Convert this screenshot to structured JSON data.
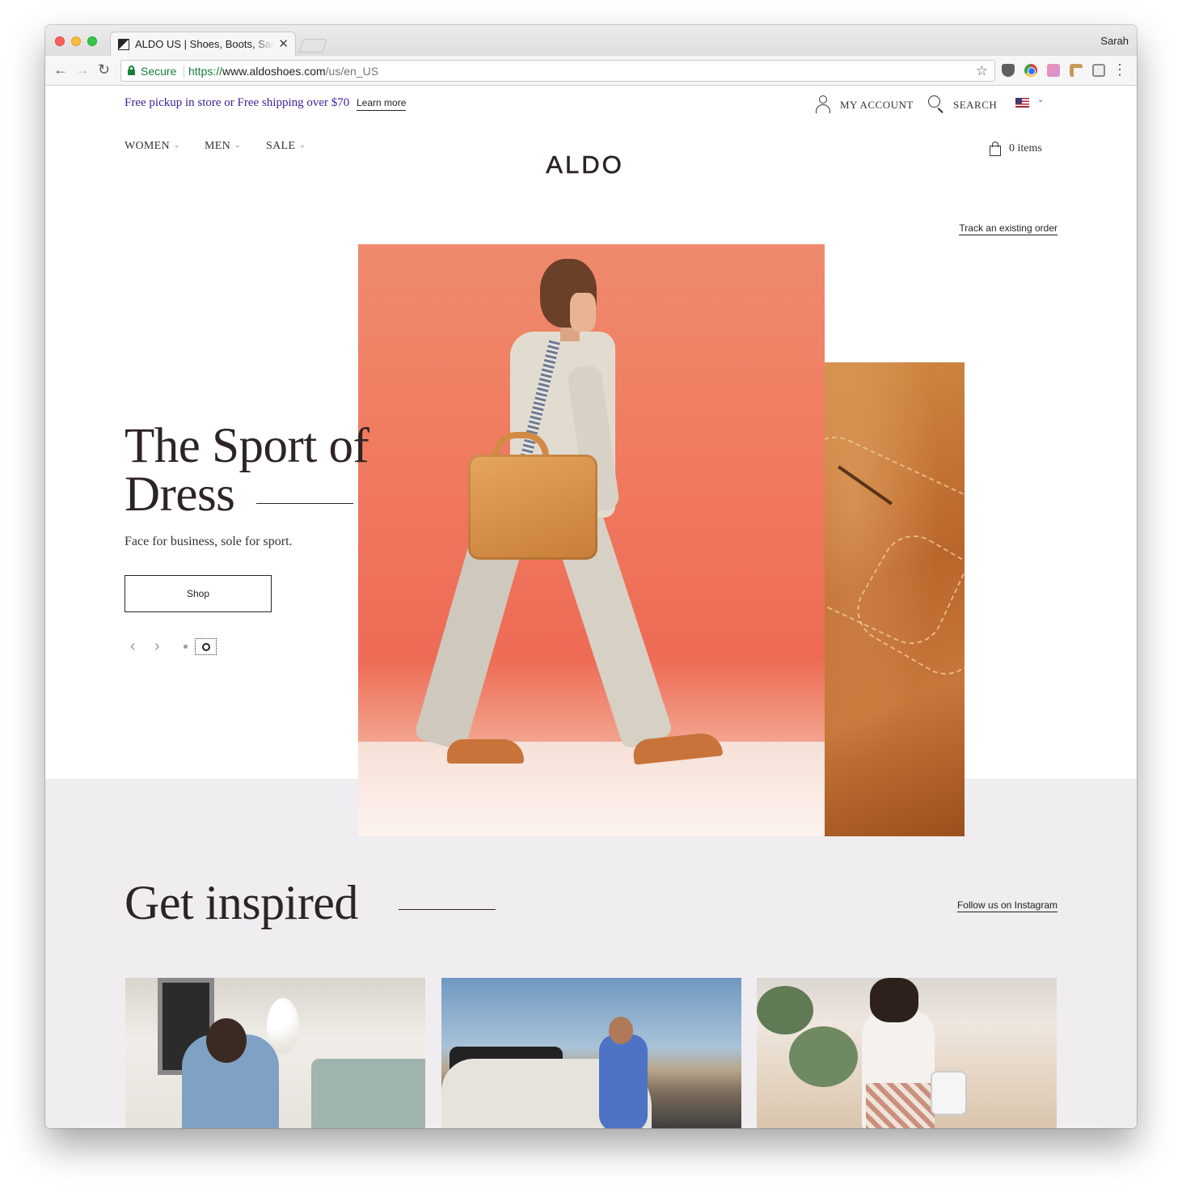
{
  "browser": {
    "tab_title": "ALDO US | Shoes, Boots, Sandals",
    "tab_close": "✕",
    "profile_name": "Sarah",
    "secure_label": "Secure",
    "url_scheme": "https://",
    "url_host": "www.aldoshoes.com",
    "url_path": "/us/en_US",
    "bookmark_icon": "☆",
    "back_icon": "←",
    "forward_icon": "→",
    "reload_icon": "↻",
    "menu_icon": "⋮"
  },
  "header": {
    "promo_text": "Free pickup in store or Free shipping over $70",
    "learn_more": "Learn more",
    "account_label": "MY ACCOUNT",
    "search_label": "SEARCH",
    "flag_caret": "⌄",
    "logo": "ALDO",
    "bag_label": "0 items",
    "nav": {
      "women": "WOMEN",
      "men": "MEN",
      "sale": "SALE",
      "caret": "⌄"
    }
  },
  "hero": {
    "track_order": "Track an existing order",
    "title_line1": "The Sport of",
    "title_line2": "Dress",
    "subtitle": "Face for business, sole for sport.",
    "shop_label": "Shop",
    "prev_icon": "‹",
    "next_icon": "›"
  },
  "inspired": {
    "title": "Get inspired",
    "follow_link": "Follow us on Instagram"
  },
  "colors": {
    "promo": "#3b1f9a",
    "brand_text": "#2d2424",
    "grey_band": "#efedef",
    "secure_green": "#188038"
  }
}
